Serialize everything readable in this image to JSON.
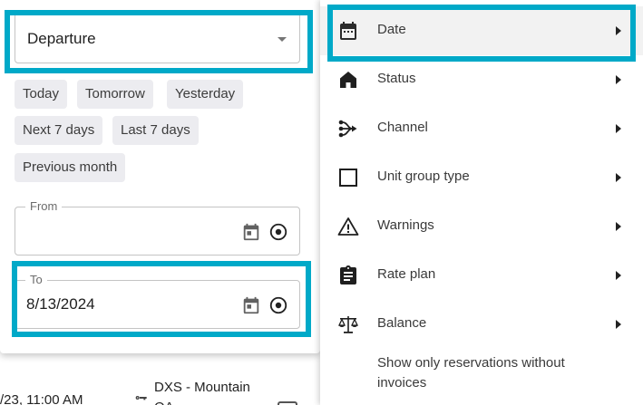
{
  "background_row": {
    "time": "/23, 11:00 AM",
    "unit_line1": "DXS - Mountain",
    "unit_line2": "QA"
  },
  "filter_panel": {
    "date_type_select": {
      "value": "Departure"
    },
    "quick_ranges": [
      "Today",
      "Tomorrow",
      "Yesterday",
      "Next 7 days",
      "Last 7 days",
      "Previous month"
    ],
    "from_field": {
      "label": "From",
      "value": ""
    },
    "to_field": {
      "label": "To",
      "value": "8/13/2024"
    }
  },
  "menu": {
    "items": [
      {
        "label": "Date",
        "icon": "calendar-icon"
      },
      {
        "label": "Status",
        "icon": "home-icon"
      },
      {
        "label": "Channel",
        "icon": "channel-icon"
      },
      {
        "label": "Unit group type",
        "icon": "square-outline-icon"
      },
      {
        "label": "Warnings",
        "icon": "warning-icon"
      },
      {
        "label": "Rate plan",
        "icon": "clipboard-icon"
      },
      {
        "label": "Balance",
        "icon": "scale-icon"
      }
    ],
    "invoice_option": "Show only reservations without invoices"
  },
  "colors": {
    "highlight": "#00a9c8",
    "chip_bg": "#ececf0",
    "active_menu_bg": "#f2f2f2"
  }
}
